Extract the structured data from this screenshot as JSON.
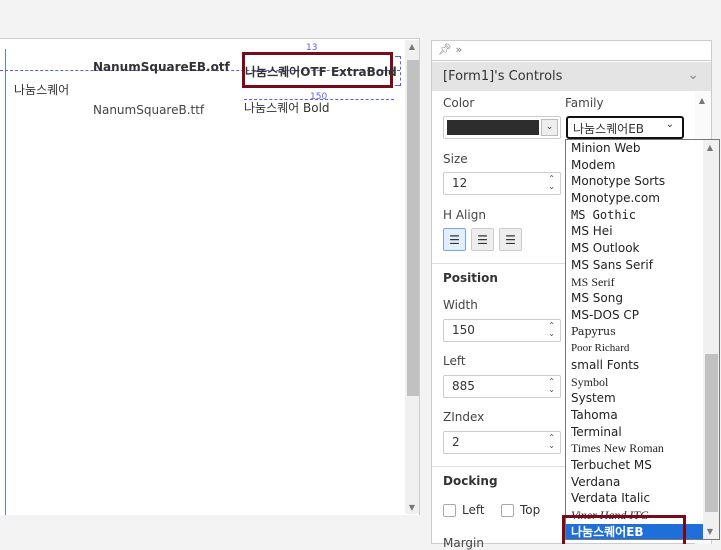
{
  "canvas": {
    "label_nanum": "나눔스퀘어",
    "label_eb_otf": "NanumSquareEB.otf",
    "label_b_ttf": "NanumSquareB.ttf",
    "label_otf_extrabold": "나눔스퀘어OTF ExtraBold",
    "label_bold": "나눔스퀘어 Bold",
    "guide_13": "13",
    "guide_150": "150"
  },
  "panel": {
    "title": "[Form1]'s Controls",
    "color_label": "Color",
    "color_value": "#2d2d2d",
    "family_label": "Family",
    "family_value": "나눔스퀘어EB",
    "size_label": "Size",
    "size_value": "12",
    "halign_label": "H Align",
    "position_label": "Position",
    "width_label": "Width",
    "width_value": "150",
    "left_label": "Left",
    "left_value": "885",
    "zindex_label": "ZIndex",
    "zindex_value": "2",
    "docking_label": "Docking",
    "dock_left": "Left",
    "dock_top": "Top",
    "margin_label": "Margin"
  },
  "font_list": [
    "Minion Web",
    "Modem",
    "Monotype Sorts",
    "Monotype.com",
    "MS Gothic",
    "MS Hei",
    "MS Outlook",
    "MS Sans Serif",
    "MS Serif",
    "MS Song",
    "MS-DOS CP",
    "Papyrus",
    "Poor Richard",
    "small Fonts",
    "Symbol",
    "System",
    "Tahoma",
    "Terminal",
    "Times New Roman",
    "Terbuchet MS",
    "Verdana",
    "Verdata Italic",
    "Viner Hand ITC",
    "나눔스퀘어EB"
  ],
  "selected_font": "나눔스퀘어EB"
}
